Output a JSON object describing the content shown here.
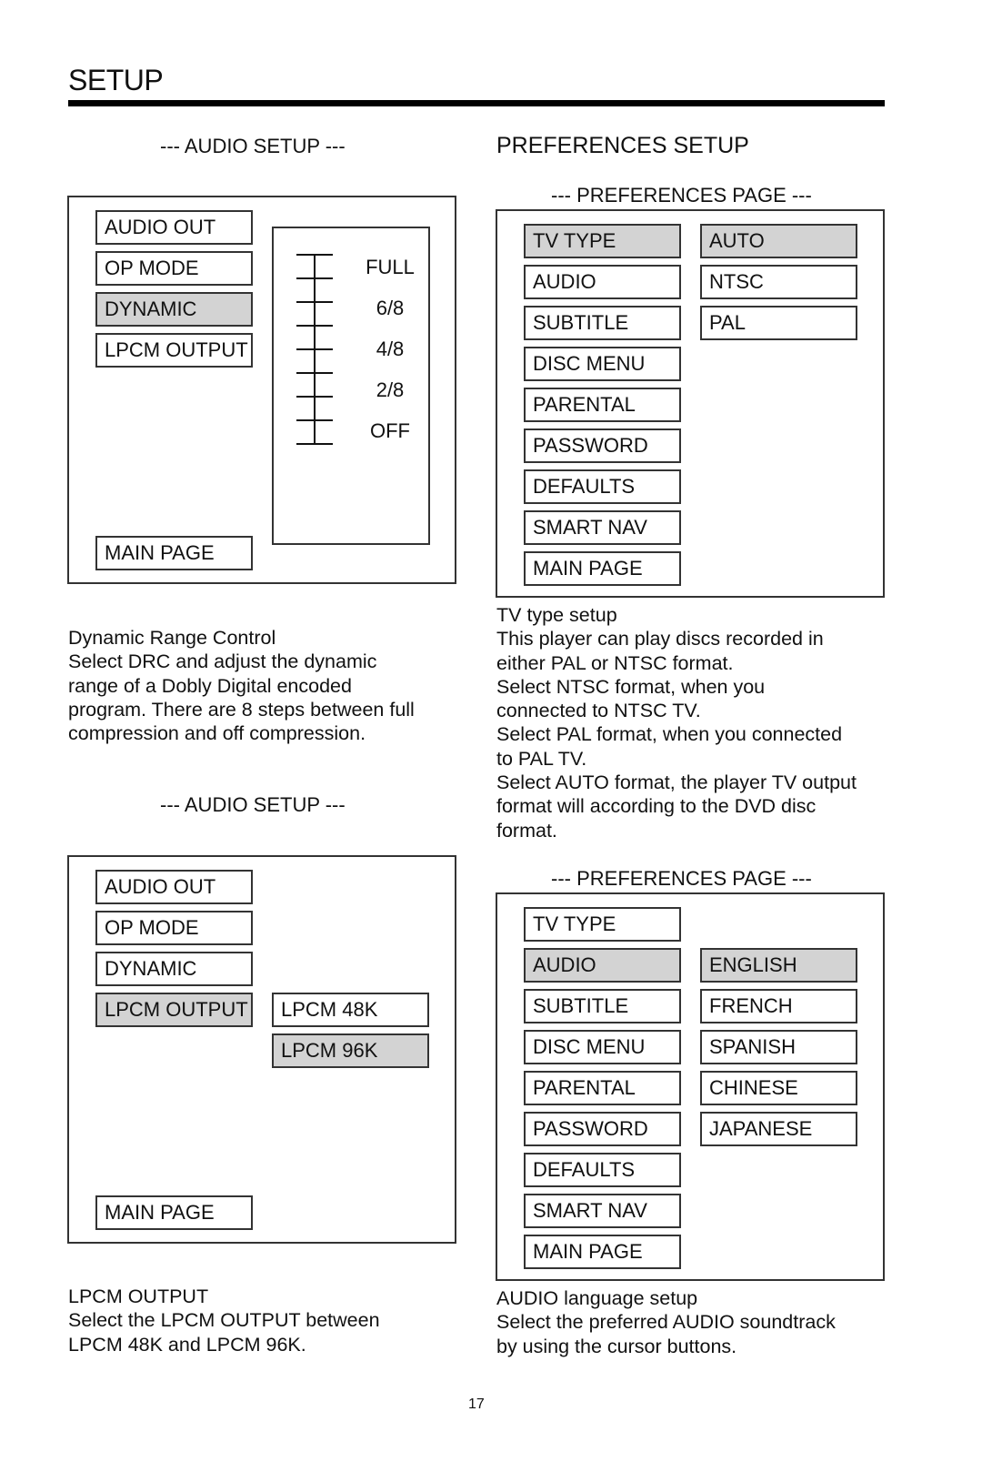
{
  "page": {
    "title": "SETUP",
    "page_number": "17"
  },
  "audio_setup_1": {
    "heading": "--- AUDIO SETUP ---",
    "menu": [
      {
        "label": "AUDIO OUT",
        "selected": false
      },
      {
        "label": "OP MODE",
        "selected": false
      },
      {
        "label": "DYNAMIC",
        "selected": true
      },
      {
        "label": "LPCM OUTPUT",
        "selected": false
      }
    ],
    "main_page": "MAIN PAGE",
    "drc_scale": {
      "labels": [
        "FULL",
        "6/8",
        "4/8",
        "2/8",
        "OFF"
      ],
      "tick_count": 9
    },
    "description": {
      "title": "Dynamic Range Control",
      "lines": [
        "Select DRC and adjust the dynamic",
        "range of a Dobly Digital encoded",
        "program.  There are 8 steps between full",
        "compression and off compression."
      ]
    }
  },
  "audio_setup_2": {
    "heading": "--- AUDIO SETUP ---",
    "menu": [
      {
        "label": "AUDIO OUT",
        "selected": false
      },
      {
        "label": "OP MODE",
        "selected": false
      },
      {
        "label": "DYNAMIC",
        "selected": false
      },
      {
        "label": "LPCM OUTPUT",
        "selected": true
      }
    ],
    "options": [
      {
        "label": "LPCM 48K",
        "selected": false
      },
      {
        "label": "LPCM 96K",
        "selected": true
      }
    ],
    "main_page": "MAIN PAGE",
    "description": {
      "title": "LPCM OUTPUT",
      "lines": [
        "Select the LPCM OUTPUT between",
        "LPCM 48K and LPCM 96K."
      ]
    }
  },
  "preferences": {
    "section_title": "PREFERENCES SETUP",
    "page_1": {
      "heading": "--- PREFERENCES PAGE ---",
      "menu": [
        {
          "label": "TV TYPE",
          "selected": true
        },
        {
          "label": "AUDIO",
          "selected": false
        },
        {
          "label": "SUBTITLE",
          "selected": false
        },
        {
          "label": "DISC MENU",
          "selected": false
        },
        {
          "label": "PARENTAL",
          "selected": false
        },
        {
          "label": "PASSWORD",
          "selected": false
        },
        {
          "label": "DEFAULTS",
          "selected": false
        },
        {
          "label": "SMART NAV",
          "selected": false
        },
        {
          "label": "MAIN PAGE",
          "selected": false
        }
      ],
      "options": [
        {
          "label": "AUTO",
          "selected": true
        },
        {
          "label": "NTSC",
          "selected": false
        },
        {
          "label": "PAL",
          "selected": false
        }
      ],
      "description": {
        "title": "TV type setup",
        "lines": [
          "This player can play discs recorded in",
          "either PAL or NTSC format.",
          "Select NTSC format, when you",
          "connected to NTSC TV.",
          "Select PAL format, when you connected",
          "to PAL TV.",
          "Select AUTO format, the player TV output",
          "format will according to the DVD disc",
          "format."
        ]
      }
    },
    "page_2": {
      "heading": "--- PREFERENCES PAGE ---",
      "menu": [
        {
          "label": "TV TYPE",
          "selected": false
        },
        {
          "label": "AUDIO",
          "selected": true
        },
        {
          "label": "SUBTITLE",
          "selected": false
        },
        {
          "label": "DISC MENU",
          "selected": false
        },
        {
          "label": "PARENTAL",
          "selected": false
        },
        {
          "label": "PASSWORD",
          "selected": false
        },
        {
          "label": "DEFAULTS",
          "selected": false
        },
        {
          "label": "SMART NAV",
          "selected": false
        },
        {
          "label": "MAIN PAGE",
          "selected": false
        }
      ],
      "options": [
        {
          "label": "ENGLISH",
          "selected": true
        },
        {
          "label": "FRENCH",
          "selected": false
        },
        {
          "label": "SPANISH",
          "selected": false
        },
        {
          "label": "CHINESE",
          "selected": false
        },
        {
          "label": "JAPANESE",
          "selected": false
        }
      ],
      "description": {
        "title": "AUDIO language setup",
        "lines": [
          "Select the preferred AUDIO soundtrack",
          "by using the cursor buttons."
        ]
      }
    }
  },
  "colors": {
    "selected_fill": "#d3d3d3",
    "border": "#333333",
    "rule": "#000000"
  }
}
